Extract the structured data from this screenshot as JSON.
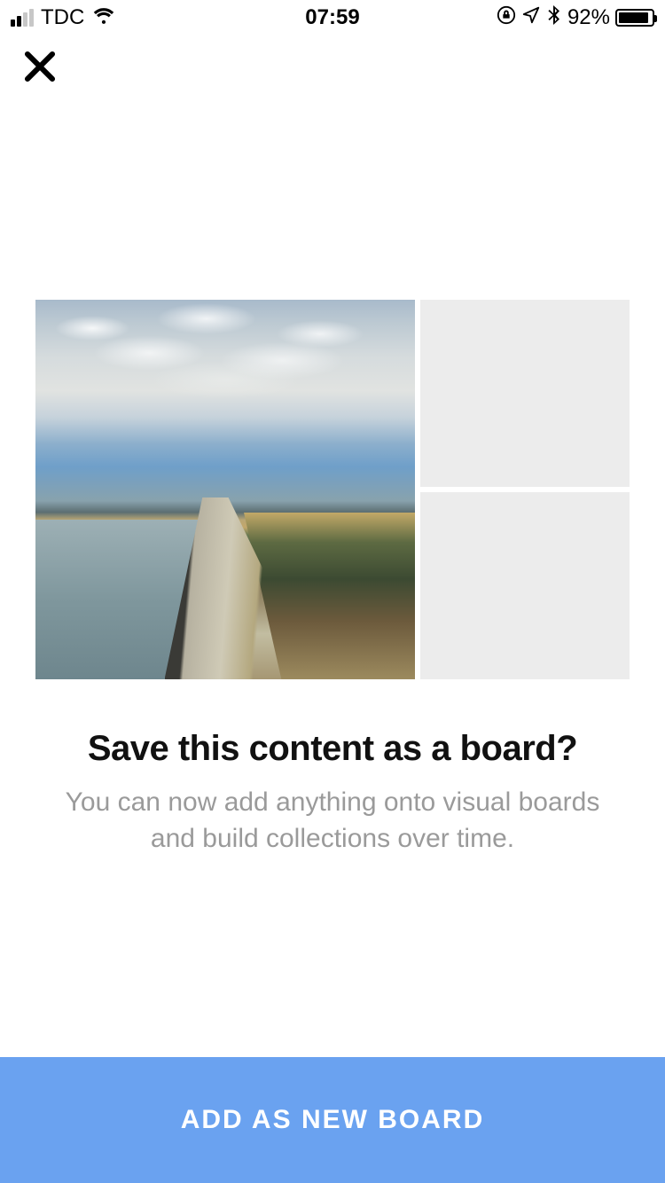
{
  "status_bar": {
    "carrier": "TDC",
    "time": "07:59",
    "battery_percent": "92%"
  },
  "dialog": {
    "heading": "Save this content as a board?",
    "subtext": "You can now add anything onto visual boards and build collections over time."
  },
  "cta": {
    "label": "ADD AS NEW BOARD"
  }
}
